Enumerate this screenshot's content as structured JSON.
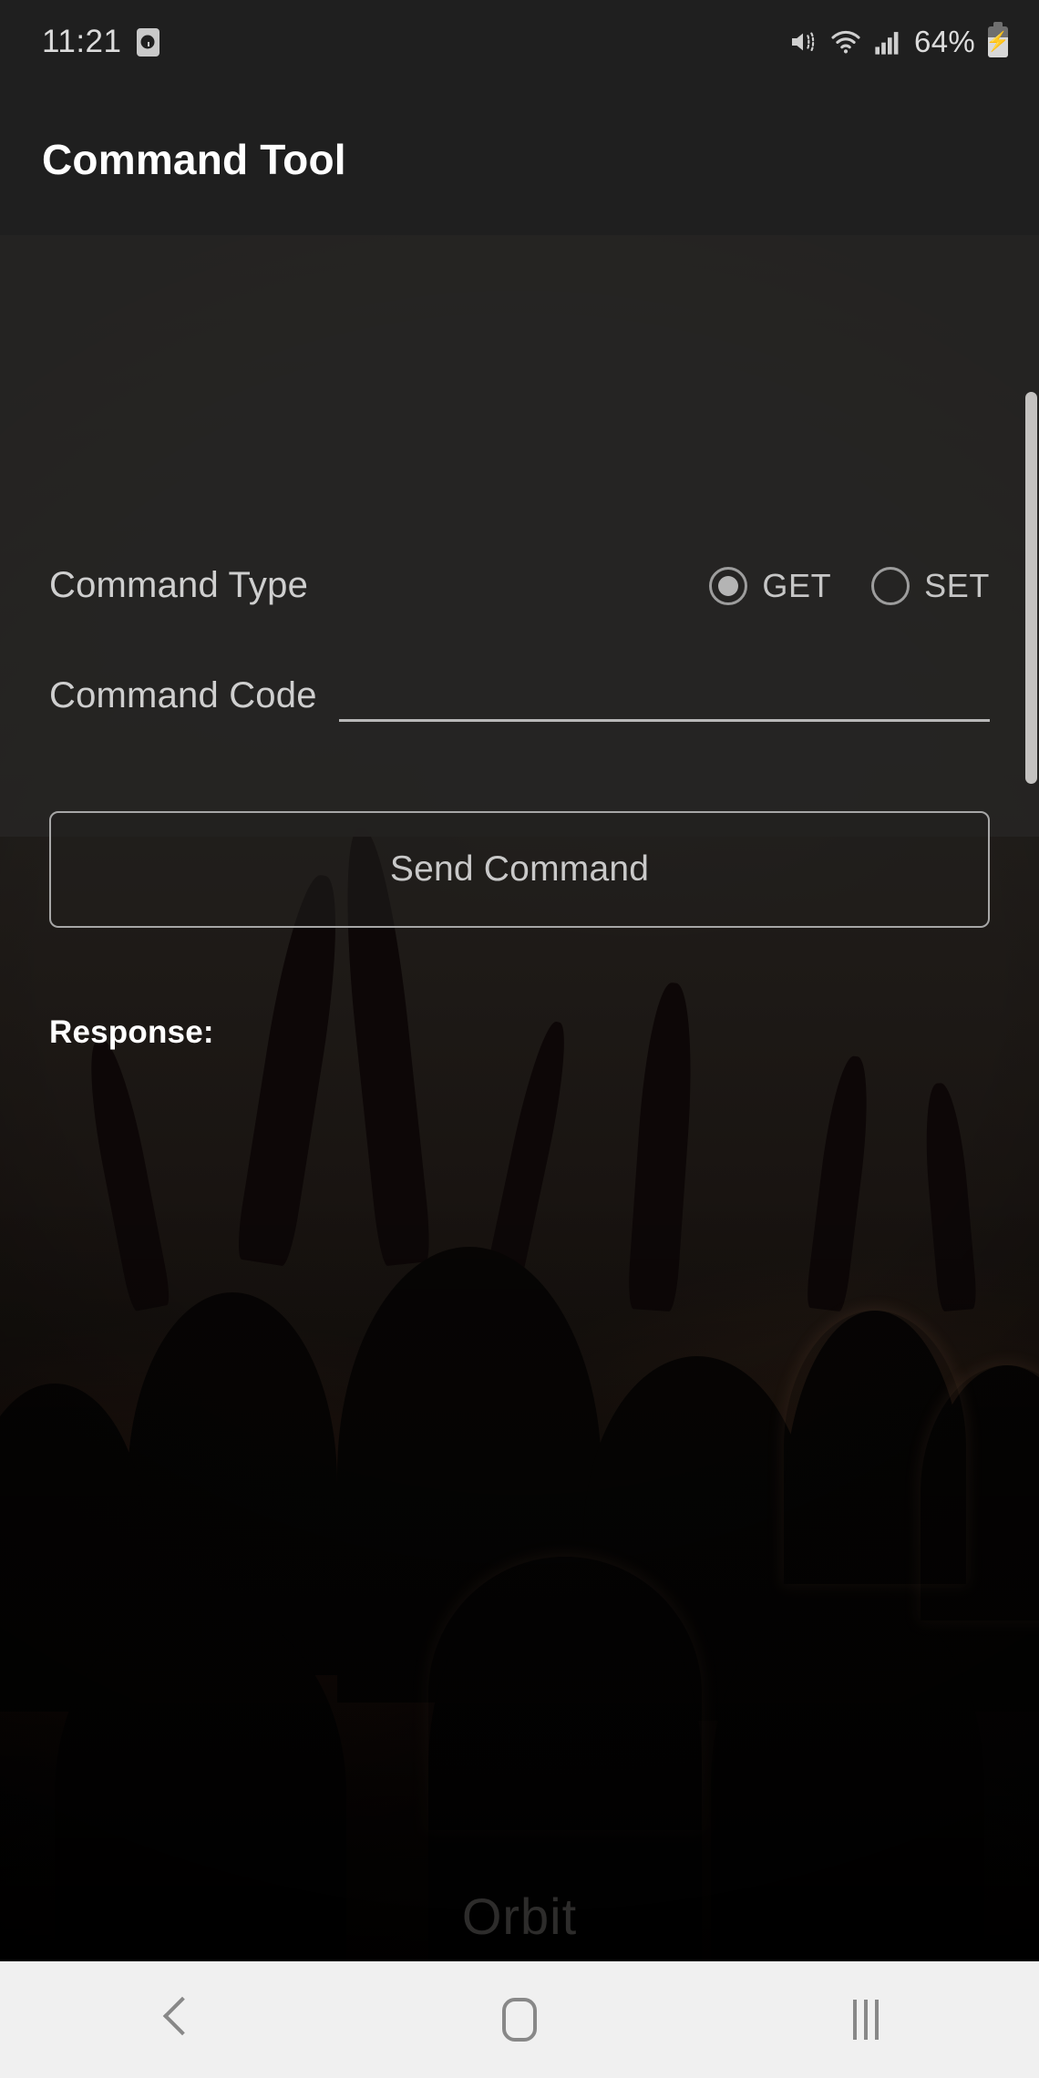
{
  "status_bar": {
    "time": "11:21",
    "alarm_icon": "alarm-clock-icon",
    "mute_icon": "vibrate-mute-icon",
    "wifi_icon": "wifi-icon",
    "signal_icon": "cellular-signal-icon",
    "battery_percent": "64%",
    "battery_icon": "battery-charging-icon",
    "battery_level": 64
  },
  "app_bar": {
    "title": "Command Tool"
  },
  "form": {
    "command_type": {
      "label": "Command Type",
      "selected": "GET",
      "options": [
        {
          "label": "GET",
          "checked": true
        },
        {
          "label": "SET",
          "checked": false
        }
      ]
    },
    "command_code": {
      "label": "Command Code",
      "value": "",
      "placeholder": ""
    },
    "send_button_label": "Send Command"
  },
  "response": {
    "label": "Response:",
    "value": ""
  },
  "watermark": {
    "text": "Orbit"
  },
  "scrollbar": {
    "position_percent": 9,
    "thumb_height_percent": 23
  },
  "nav_bar": {
    "back_icon": "back-chevron-icon",
    "home_icon": "home-square-icon",
    "recents_icon": "recents-bars-icon"
  },
  "colors": {
    "app_bar_bg": "#1f1f1f",
    "panel_bg": "#252423",
    "text_primary": "#ffffff",
    "text_secondary": "#cfcfcf",
    "accent_outline": "#a7a7a7",
    "nav_bar_bg": "#f0f0f0",
    "nav_icon": "#888888"
  }
}
